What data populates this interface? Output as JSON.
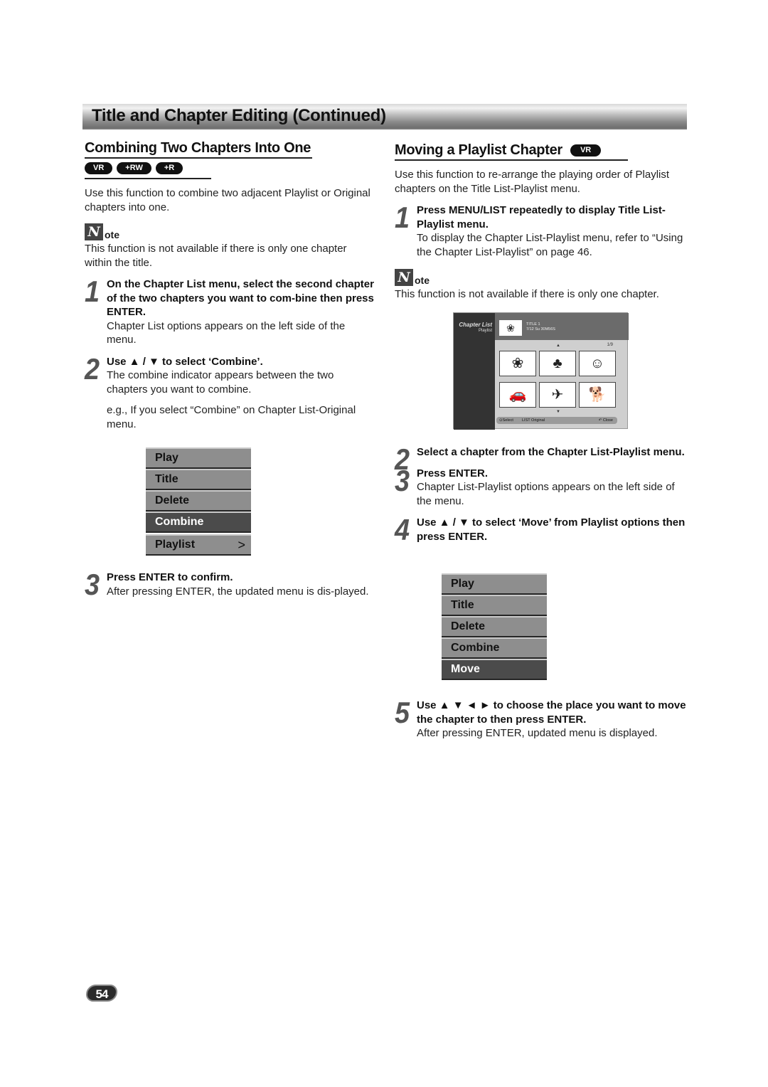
{
  "page": {
    "title": "Title and Chapter Editing (Continued)",
    "page_number": "54"
  },
  "left": {
    "heading": "Combining Two Chapters Into One",
    "badges": [
      "VR",
      "+RW",
      "+R"
    ],
    "intro": "Use this function to combine two adjacent Playlist or Original chapters into one.",
    "note_label": "ote",
    "note_icon": "N",
    "note_text": "This function is not available if there is only one chapter within the title.",
    "steps": [
      {
        "num": "1",
        "bold": "On the Chapter List menu, select the second chapter of the two chapters you want to com-bine then press ENTER.",
        "desc": "Chapter List options appears on the left side of the menu."
      },
      {
        "num": "2",
        "bold": "Use ▲ / ▼ to select ‘Combine’.",
        "desc": "The combine indicator appears between the two chapters you want to combine.",
        "extra": "e.g., If you select “Combine” on Chapter List-Original menu."
      },
      {
        "num": "3",
        "bold": "Press ENTER to confirm.",
        "desc": "After pressing ENTER, the updated menu is dis-played."
      }
    ],
    "menu": {
      "items": [
        "Play",
        "Title",
        "Delete",
        "Combine",
        "Playlist"
      ],
      "selected": "Combine",
      "submenu_arrow": ">"
    }
  },
  "right": {
    "heading": "Moving a Playlist Chapter",
    "badge": "VR",
    "intro": "Use this function to re-arrange the playing order of Playlist chapters on the Title List-Playlist menu.",
    "steps": [
      {
        "num": "1",
        "bold": "Press MENU/LIST repeatedly to display Title List-Playlist menu.",
        "desc": "To display the Chapter List-Playlist menu, refer to “Using the Chapter List-Playlist” on page 46."
      },
      {
        "num": "2",
        "bold": "Select a chapter from the Chapter List-Playlist menu.",
        "desc": ""
      },
      {
        "num": "3",
        "bold": "Press ENTER.",
        "desc": "Chapter List-Playlist options appears on the left side of the menu."
      },
      {
        "num": "4",
        "bold": "Use ▲ / ▼ to select ‘Move’ from Playlist options then press ENTER.",
        "desc": ""
      },
      {
        "num": "5",
        "bold": "Use ▲ ▼ ◄ ► to choose the place you want to move the chapter to then press ENTER.",
        "desc": "After pressing ENTER, updated menu is displayed."
      }
    ],
    "note_label": "ote",
    "note_icon": "N",
    "note_text": "This function is not available if there is only one chapter.",
    "osd": {
      "title": "Chapter List",
      "subtitle": "Playlist",
      "title_name": "TITLE 1",
      "title_info": "7/12  Su    30M56S",
      "page": "1/9",
      "up_arrow": "▲",
      "down_arrow": "▼",
      "thumbnails": [
        "rose-icon",
        "tree-icon",
        "cartoon-icon",
        "car-icon",
        "shuttle-icon",
        "dog-icon"
      ],
      "thumbnail_glyphs": [
        "❀",
        "♣",
        "☺",
        "🚗",
        "✈",
        "🐕"
      ],
      "main_thumb_glyph": "❀",
      "footer_select": "⊙Select",
      "footer_list": "LIST Original",
      "footer_close": "↶ Close"
    },
    "menu": {
      "items": [
        "Play",
        "Title",
        "Delete",
        "Combine",
        "Move"
      ],
      "selected": "Move"
    }
  }
}
